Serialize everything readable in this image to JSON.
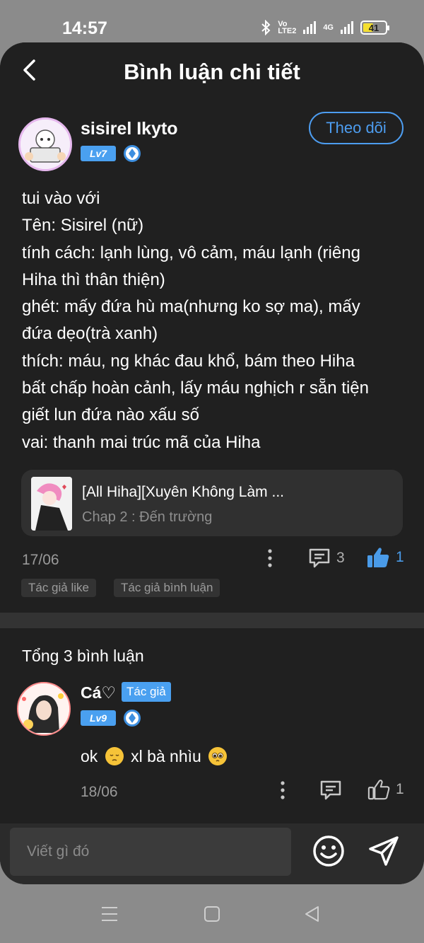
{
  "status": {
    "time": "14:57",
    "network_top": "Vo",
    "network_bottom": "LTE2",
    "net_gen": "4G",
    "battery": "41"
  },
  "header": {
    "title": "Bình luận chi tiết"
  },
  "post": {
    "username": "sisirel Ikyto",
    "level": "Lv7",
    "follow_label": "Theo dõi",
    "body_lines": [
      "tui vào với",
      "Tên: Sisirel (nữ)",
      "tính cách: lạnh lùng, vô cảm, máu lạnh (riêng",
      "Hiha thì thân thiện)",
      "ghét: mấy đứa hù ma(nhưng ko sợ ma), mấy",
      "đứa dẹo(trà xanh)",
      "thích: máu, ng khác đau khổ, bám theo Hiha",
      "bất chấp hoàn cảnh, lấy máu nghịch r sẵn tiện",
      "giết lun đứa nào xấu số",
      "vai: thanh mai trúc mã của Hiha"
    ],
    "story": {
      "title": "[All Hiha][Xuyên Không Làm ...",
      "chapter": "Chap 2 : Đến trường"
    },
    "date": "17/06",
    "comment_count": "3",
    "like_count": "1",
    "tags": [
      "Tác giả like",
      "Tác giả bình luận"
    ]
  },
  "comments": {
    "total_label": "Tổng 3 bình luận",
    "items": [
      {
        "name": "Cá♡",
        "author_label": "Tác giả",
        "level": "Lv9",
        "text_a": "ok",
        "text_b": "xl bà nhìu",
        "date": "18/06",
        "like_count": "1"
      }
    ]
  },
  "input": {
    "placeholder": "Viết gì đó"
  },
  "colors": {
    "accent": "#4aa0f0",
    "background": "#202020",
    "muted": "#9a9a9a"
  }
}
